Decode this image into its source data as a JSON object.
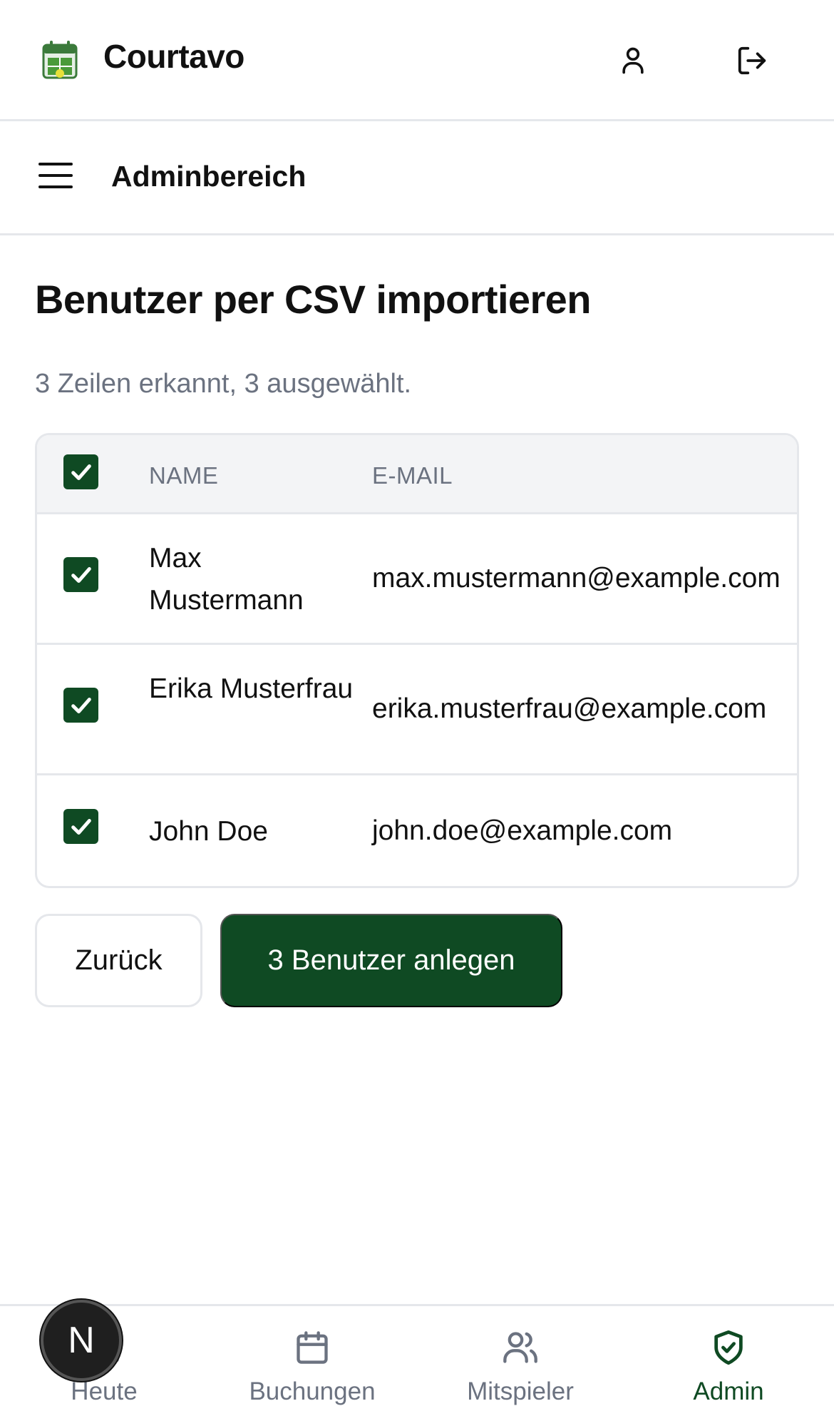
{
  "app": {
    "name": "Courtavo"
  },
  "subheader": {
    "title": "Adminbereich"
  },
  "page": {
    "title": "Benutzer per CSV importieren",
    "summary": "3 Zeilen erkannt, 3 ausgewählt."
  },
  "table": {
    "headers": {
      "name": "NAME",
      "email": "E-MAIL"
    },
    "rows": [
      {
        "name": "Max Mustermann",
        "email": "max.mustermann@example.com",
        "selected": true
      },
      {
        "name": "Erika Musterfrau",
        "email": "erika.musterfrau@example.com",
        "selected": true
      },
      {
        "name": "John Doe",
        "email": "john.doe@example.com",
        "selected": true
      }
    ]
  },
  "actions": {
    "back_label": "Zurück",
    "create_label": "3 Benutzer anlegen"
  },
  "nav": {
    "items": [
      {
        "label": "Heute",
        "icon": "home-icon"
      },
      {
        "label": "Buchungen",
        "icon": "calendar-icon"
      },
      {
        "label": "Mitspieler",
        "icon": "users-icon"
      },
      {
        "label": "Admin",
        "icon": "shield-check-icon",
        "active": true
      }
    ]
  },
  "dev_badge": {
    "letter": "N"
  },
  "colors": {
    "accent": "#0f4a23",
    "muted": "#6b7280",
    "border": "#e5e7eb"
  }
}
